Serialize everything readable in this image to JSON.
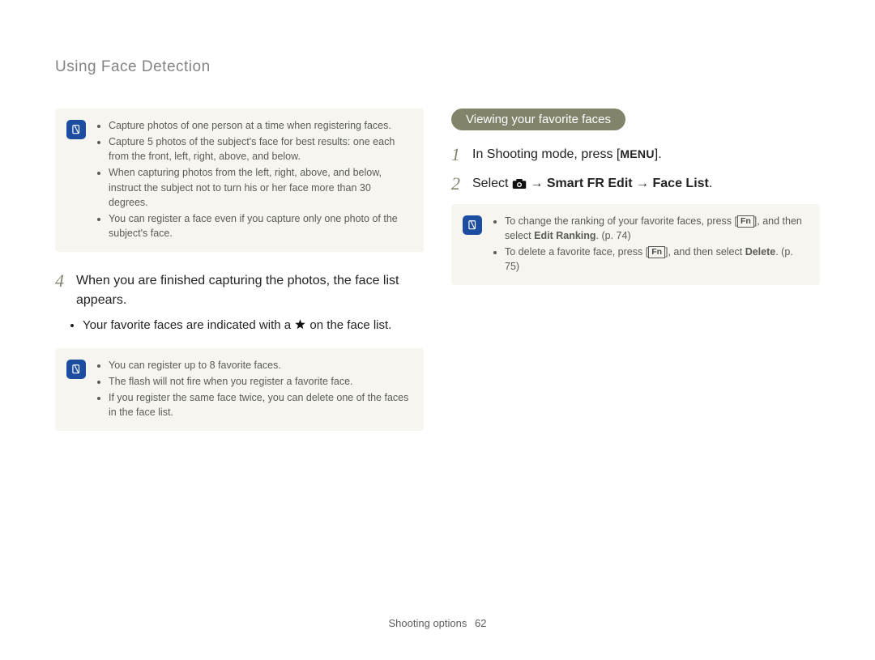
{
  "header": {
    "title": "Using Face Detection"
  },
  "left": {
    "note1": {
      "items": [
        "Capture photos of one person at a time when registering faces.",
        "Capture 5 photos of the subject's face for best results: one each from the front, left, right, above, and below.",
        "When capturing photos from the left, right, above, and below, instruct the subject not to turn his or her face more than 30 degrees.",
        "You can register a face even if you capture only one photo of the subject's face."
      ]
    },
    "step4": {
      "num": "4",
      "text": "When you are finished capturing the photos, the face list appears."
    },
    "sub": {
      "pre": "Your favorite faces are indicated with a ",
      "post": " on the face list."
    },
    "note2": {
      "items": [
        "You can register up to 8 favorite faces.",
        "The flash will not fire when you register a favorite face.",
        "If you register the same face twice, you can delete one of the faces in the face list."
      ]
    }
  },
  "right": {
    "pill": "Viewing your favorite faces",
    "step1": {
      "num": "1",
      "pre": "In Shooting mode, press [",
      "menu": "MENU",
      "post": "]."
    },
    "step2": {
      "num": "2",
      "pre": "Select ",
      "arrow1": " → ",
      "b1": "Smart FR Edit",
      "arrow2": " → ",
      "b2": "Face List",
      "post": "."
    },
    "note": {
      "item1_pre": "To change the ranking of your favorite faces, press [",
      "item1_fn": "Fn",
      "item1_mid": "], and then select ",
      "item1_b": "Edit Ranking",
      "item1_post": ". (p. 74)",
      "item2_pre": "To delete a favorite face, press [",
      "item2_fn": "Fn",
      "item2_mid": "], and then select ",
      "item2_b": "Delete",
      "item2_post": ". (p. 75)"
    }
  },
  "footer": {
    "label": "Shooting options",
    "page": "62"
  }
}
